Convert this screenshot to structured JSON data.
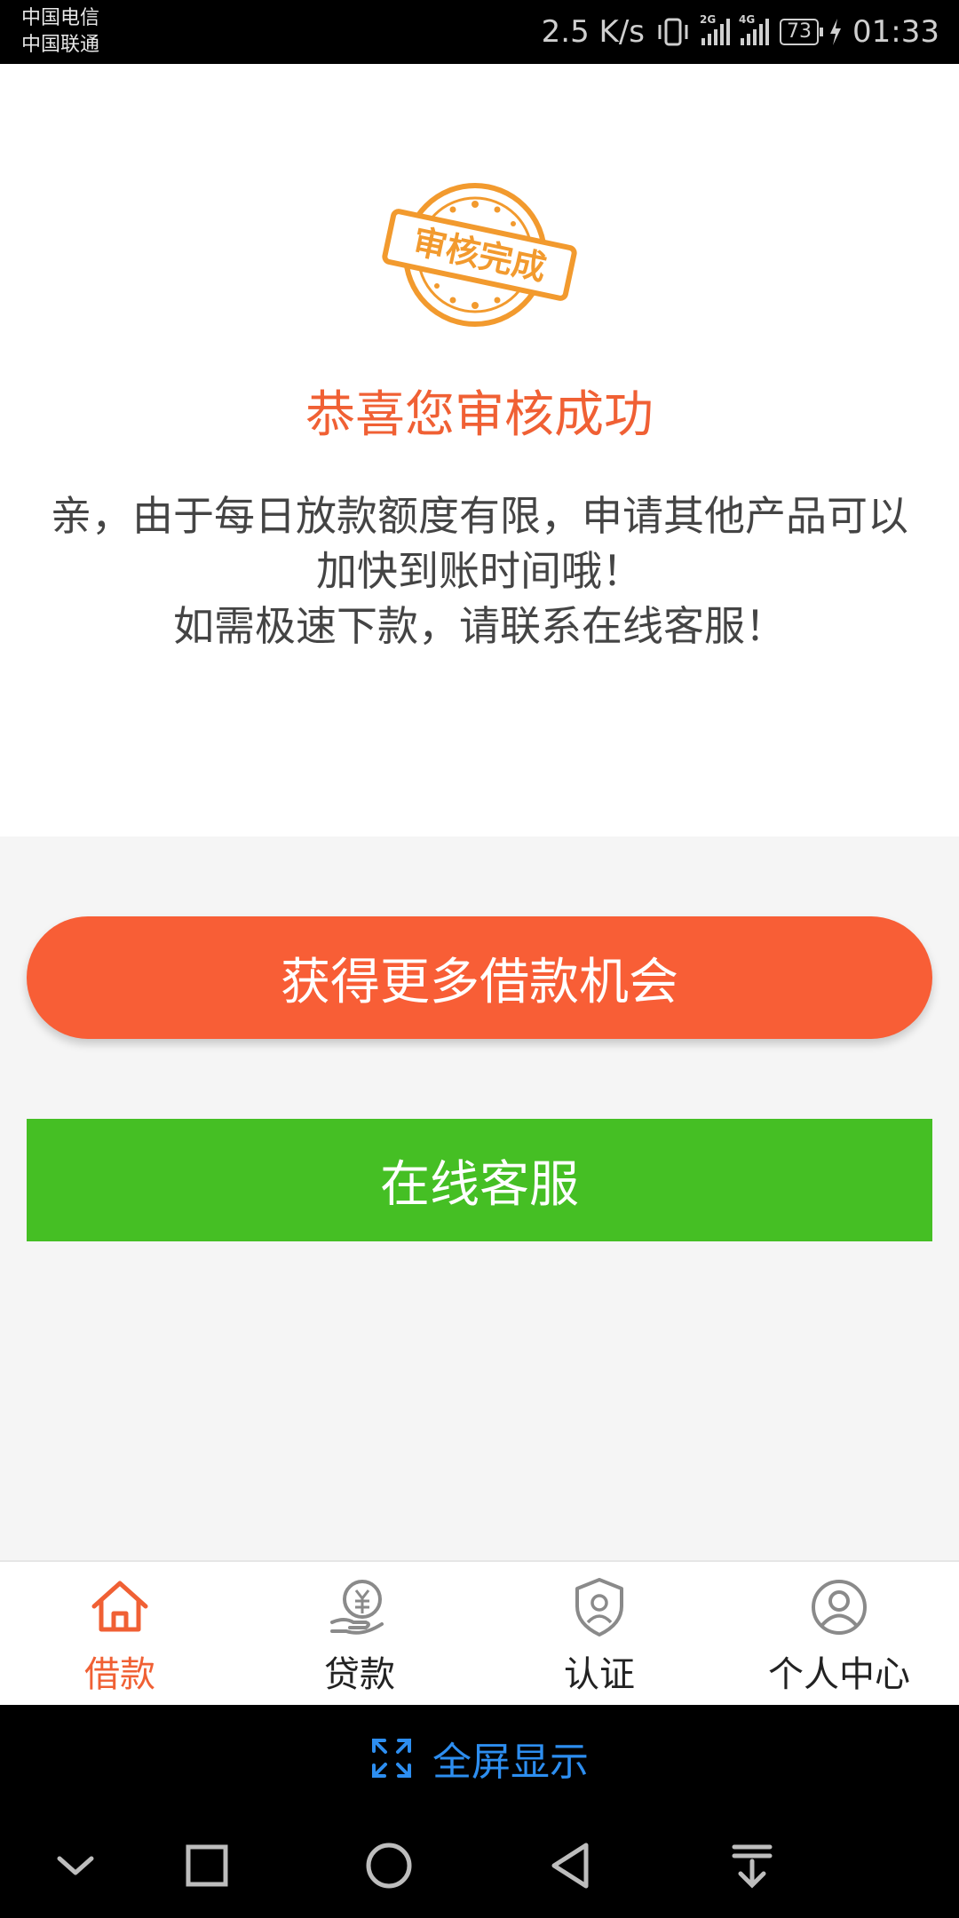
{
  "status_bar": {
    "carrier_1": "中国电信",
    "carrier_2": "中国联通",
    "net_speed": "2.5 K/s",
    "sim1_tag": "2G",
    "sim2_tag": "4G",
    "battery": "73",
    "time": "01:33"
  },
  "review": {
    "stamp_text": "审核完成",
    "title": "恭喜您审核成功",
    "message_line1": "亲，由于每日放款额度有限，申请其他产品可以加快到账时间哦！",
    "message_line2": "如需极速下款，请联系在线客服！"
  },
  "actions": {
    "more_loans_label": "获得更多借款机会",
    "online_service_label": "在线客服"
  },
  "bottom_nav": {
    "items": [
      {
        "label": "借款",
        "icon": "home-icon",
        "active": true
      },
      {
        "label": "贷款",
        "icon": "yuan-hand-icon",
        "active": false
      },
      {
        "label": "认证",
        "icon": "shield-check-icon",
        "active": false
      },
      {
        "label": "个人中心",
        "icon": "user-circle-icon",
        "active": false
      }
    ]
  },
  "fullscreen_bar": {
    "label": "全屏显示",
    "icon": "expand-icon"
  },
  "colors": {
    "accent_orange": "#f85e36",
    "service_green": "#45bf24",
    "title_orange": "#f06034",
    "fullscreen_blue": "#2d8ef0"
  }
}
